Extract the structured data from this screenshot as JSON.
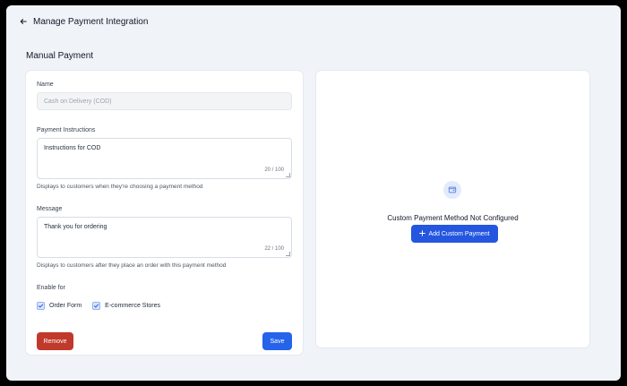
{
  "header": {
    "title": "Manage Payment Integration"
  },
  "section": {
    "title": "Manual Payment"
  },
  "form": {
    "name_label": "Name",
    "name_placeholder": "Cash on Delivery (COD)",
    "instructions_label": "Payment Instructions",
    "instructions_value": "Instructions for COD",
    "instructions_count": "20 / 100",
    "instructions_help": "Displays to customers when they're choosing a payment method",
    "message_label": "Message",
    "message_value": "Thank you for ordering",
    "message_count": "22 / 100",
    "message_help": "Displays to customers after they place an order with this payment method",
    "enable_label": "Enable for",
    "options": [
      {
        "label": "Order Form",
        "checked": true
      },
      {
        "label": "E-commerce Stores",
        "checked": true
      }
    ],
    "remove_label": "Remove",
    "save_label": "Save"
  },
  "custom": {
    "empty_title": "Custom Payment Method Not Configured",
    "add_label": "Add Custom Payment"
  },
  "colors": {
    "primary": "#2563eb",
    "danger": "#c0392b",
    "background": "#f0f3f8"
  },
  "icons": {
    "back": "arrow-left-icon",
    "empty": "wallet-icon",
    "add": "plus-icon",
    "check": "check-icon"
  }
}
